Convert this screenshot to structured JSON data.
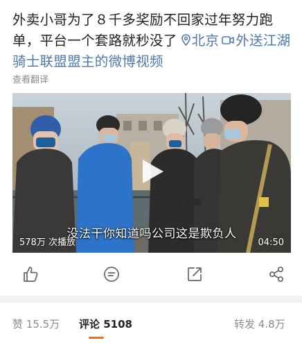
{
  "post": {
    "text": "外卖小哥为了８千多奖励不回家过年努力跑单，平台一个套路就秒没了",
    "location": "北京",
    "video_link": "外送江湖骑士联盟盟主的微博视频",
    "translate": "查看翻译"
  },
  "video": {
    "subtitle": "没法干你知道吗公司这是欺负人",
    "views": "578万 次播放",
    "duration": "04:50"
  },
  "icons": {
    "like": "thumbs-up-icon",
    "comment": "comment-bubble-icon",
    "repost": "repost-icon",
    "share": "share-icon",
    "location": "location-pin-icon",
    "video": "video-camera-icon"
  },
  "tabs": {
    "likes_label": "赞",
    "likes_count": "15.5万",
    "comments_label": "评论",
    "comments_count": "5108",
    "reposts_label": "转发",
    "reposts_count": "4.8万"
  },
  "colors": {
    "link": "#4e79b0",
    "accent": "#f36d21"
  }
}
